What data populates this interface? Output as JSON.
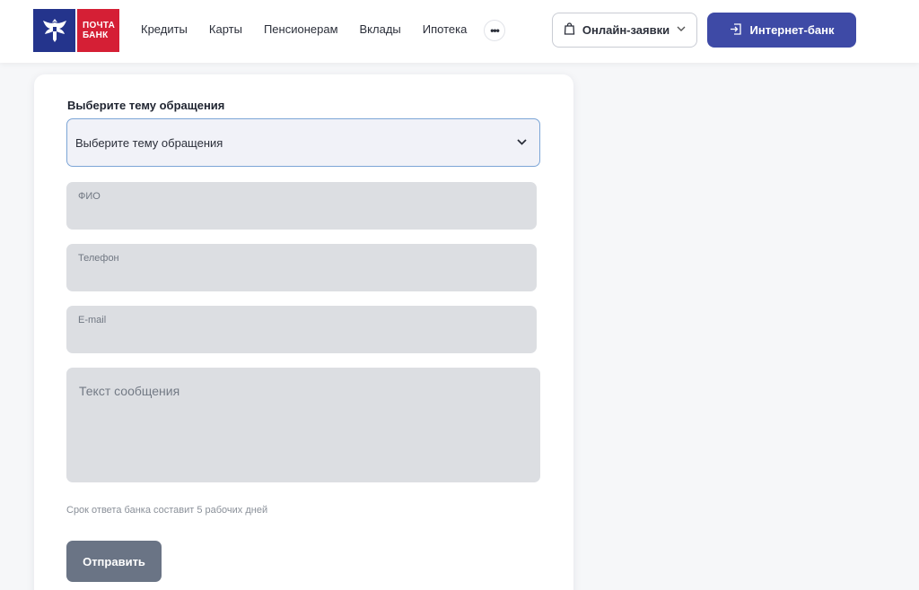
{
  "brand": {
    "logo_line1": "ПОЧТА",
    "logo_line2": "БАНК",
    "emblem_color": "#24348c",
    "logo_color": "#d51f35"
  },
  "nav": {
    "items": [
      "Кредиты",
      "Карты",
      "Пенсионерам",
      "Вклады",
      "Ипотека"
    ],
    "more_icon": "more-dots-icon"
  },
  "header_actions": {
    "online_label": "Онлайн-заявки",
    "bank_label": "Интернет-банк",
    "bank_color": "#3e4aa6"
  },
  "form": {
    "topic_title": "Выберите тему обращения",
    "topic_value": "Выберите тему обращения",
    "name_label": "ФИО",
    "phone_label": "Телефон",
    "email_label": "E-mail",
    "message_placeholder": "Текст сообщения",
    "hint": "Срок ответа банка составит 5 рабочих дней",
    "submit_label": "Отправить",
    "submit_color": "#6a7485"
  }
}
